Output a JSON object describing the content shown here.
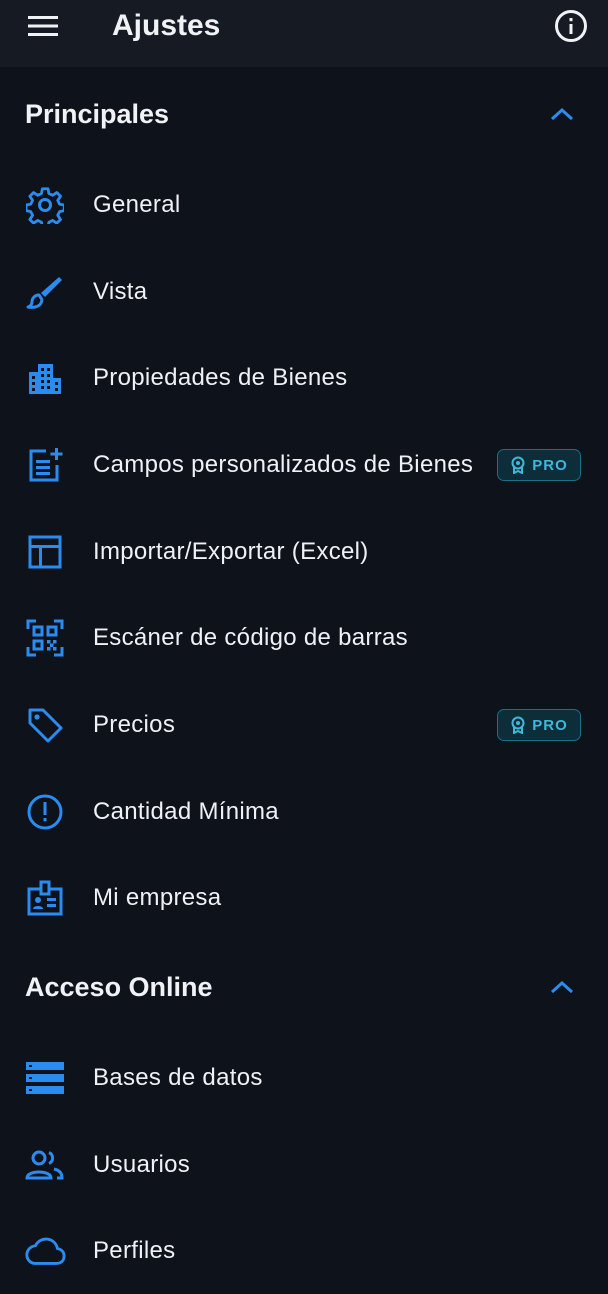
{
  "appbar": {
    "title": "Ajustes",
    "menu_icon": "hamburger-menu-icon",
    "info_icon": "info-circle-icon"
  },
  "sections": [
    {
      "label": "Principales",
      "expanded": true,
      "items": [
        {
          "label": "General",
          "icon": "gear-icon"
        },
        {
          "label": "Vista",
          "icon": "brush-icon"
        },
        {
          "label": "Propiedades de Bienes",
          "icon": "building-icon"
        },
        {
          "label": "Campos personalizados de Bienes",
          "icon": "post-add-icon",
          "badge": "PRO"
        },
        {
          "label": "Importar/Exportar (Excel)",
          "icon": "table-icon"
        },
        {
          "label": "Escáner de código de barras",
          "icon": "qr-code-icon"
        },
        {
          "label": "Precios",
          "icon": "tag-icon",
          "badge": "PRO"
        },
        {
          "label": "Cantidad Mínima",
          "icon": "alert-circle-icon"
        },
        {
          "label": "Mi empresa",
          "icon": "badge-id-icon"
        }
      ]
    },
    {
      "label": "Acceso Online",
      "expanded": true,
      "items": [
        {
          "label": "Bases de datos",
          "icon": "storage-icon"
        },
        {
          "label": "Usuarios",
          "icon": "people-icon"
        },
        {
          "label": "Perfiles",
          "icon": "cloud-icon"
        }
      ]
    }
  ],
  "colors": {
    "background": "#0e121a",
    "appbar": "#161b23",
    "accent": "#2b8cf0",
    "pro_badge_text": "#3fb7d9"
  }
}
